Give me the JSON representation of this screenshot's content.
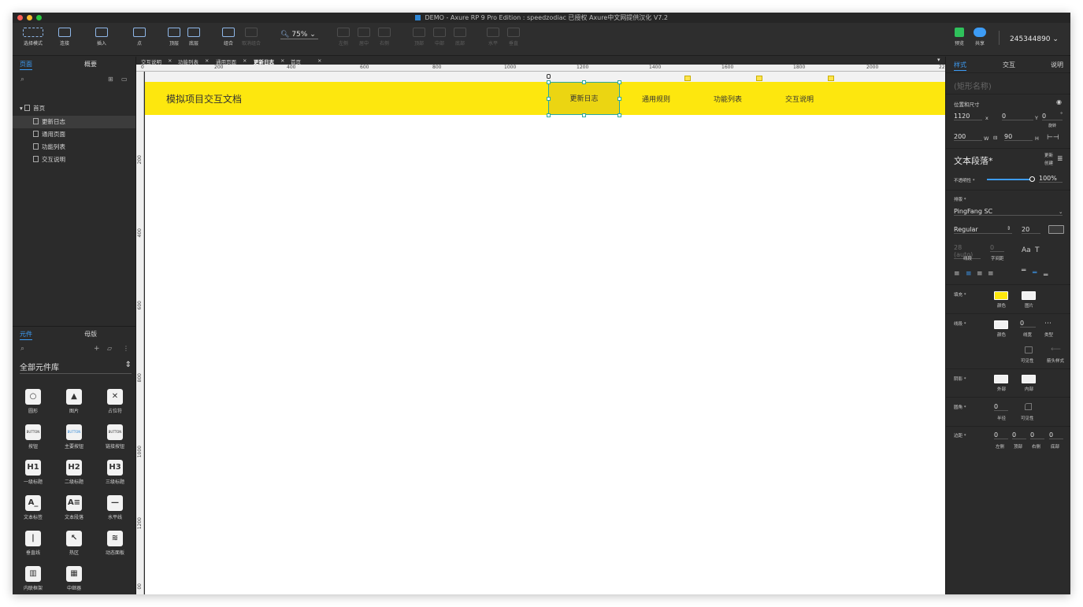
{
  "window": {
    "title": "DEMO - Axure RP 9 Pro Edition : speedzodiac 已授权    Axure中文网提供汉化 V7.2"
  },
  "toolbar": {
    "select_mode": "选择模式",
    "connect": "连接",
    "insert": "插入",
    "point": "点",
    "top": "顶层",
    "bottom": "底层",
    "group": "组合",
    "ungroup": "取消组合",
    "zoom": "75%",
    "align_left": "左侧",
    "align_center": "居中",
    "align_right": "右侧",
    "align_top": "顶部",
    "align_middle": "中部",
    "align_bottom": "底部",
    "distribute_h": "水平",
    "distribute_v": "垂直",
    "preview": "预览",
    "share": "共享",
    "account": "245344890"
  },
  "left_panel": {
    "tab_pages": "页面",
    "tab_outline": "概要",
    "tree": {
      "home": "首页",
      "items": [
        "更新日志",
        "通用页面",
        "功能列表",
        "交互说明"
      ]
    },
    "tab_widgets": "元件",
    "tab_masters": "母版",
    "library": "全部元件库",
    "widgets": [
      {
        "label": "圆形",
        "glyph": "○"
      },
      {
        "label": "图片",
        "glyph": "▲"
      },
      {
        "label": "占位符",
        "glyph": "✕"
      },
      {
        "label": "按钮",
        "glyph": "BUTTON"
      },
      {
        "label": "主要按钮",
        "glyph": "BUTTON"
      },
      {
        "label": "链接按钮",
        "glyph": "BUTTON"
      },
      {
        "label": "一级标题",
        "glyph": "H1"
      },
      {
        "label": "二级标题",
        "glyph": "H2"
      },
      {
        "label": "三级标题",
        "glyph": "H3"
      },
      {
        "label": "文本标签",
        "glyph": "A_"
      },
      {
        "label": "文本段落",
        "glyph": "A≡"
      },
      {
        "label": "水平线",
        "glyph": "—"
      },
      {
        "label": "垂直线",
        "glyph": "|"
      },
      {
        "label": "热区",
        "glyph": "↖"
      },
      {
        "label": "动态面板",
        "glyph": "≋"
      },
      {
        "label": "内联框架",
        "glyph": "▥"
      },
      {
        "label": "中继器",
        "glyph": "▦"
      }
    ]
  },
  "canvas": {
    "tabs": [
      "交互说明",
      "功能列表",
      "通用页面",
      "更新日志",
      "首页"
    ],
    "active_tab": "更新日志",
    "ruler_h": [
      "0",
      "200",
      "400",
      "600",
      "800",
      "1000",
      "1200",
      "1400",
      "1600",
      "1800",
      "2000",
      "220"
    ],
    "ruler_v": [
      "200",
      "400",
      "600",
      "800",
      "1000",
      "1200",
      "00"
    ],
    "page_title": "模拟项目交互文档",
    "nav": [
      "更新日志",
      "通用规则",
      "功能列表",
      "交互说明"
    ]
  },
  "right_panel": {
    "tab_style": "样式",
    "tab_interact": "交互",
    "tab_notes": "说明",
    "shape_name_placeholder": "(矩形名称)",
    "pos_size_label": "位置和尺寸",
    "x": "1120",
    "x_unit": "x",
    "y": "0",
    "y_unit": "Y",
    "rotate": "0",
    "rotate_label": "旋转",
    "w": "200",
    "w_unit": "W",
    "h": "90",
    "h_unit": "H",
    "style_name": "文本段落*",
    "update": "更新",
    "create": "创建",
    "opacity_label": "不透明性 *",
    "opacity": "100%",
    "typography_label": "排版 *",
    "font": "PingFang SC",
    "font_weight": "Regular",
    "font_size": "20",
    "line_height": "28 (auto)",
    "char_spacing": "0",
    "line_height_label": "线段",
    "char_spacing_label": "字间距",
    "fill_label": "填充 *",
    "fill_color_label": "颜色",
    "fill_image_label": "图片",
    "border_label": "线段 *",
    "border_color_label": "颜色",
    "border_width": "0",
    "border_width_label": "线宽",
    "border_type_label": "类型",
    "visibility_label": "可见性",
    "arrow_label": "箭头样式",
    "shadow_label": "阴影 *",
    "shadow_outer": "外部",
    "shadow_inner": "内部",
    "radius_label": "圆角 *",
    "radius": "0",
    "radius_value_label": "半径",
    "radius_vis_label": "可见性",
    "padding_label": "边距 *",
    "padding": [
      "0",
      "0",
      "0",
      "0"
    ],
    "padding_labels": [
      "左侧",
      "顶部",
      "右侧",
      "底部"
    ]
  },
  "colors": {
    "header_yellow": "#fde70e",
    "selected_yellow": "#ebd512",
    "accent_blue": "#3d9cf5",
    "selection_handle": "#2aa8a0"
  }
}
